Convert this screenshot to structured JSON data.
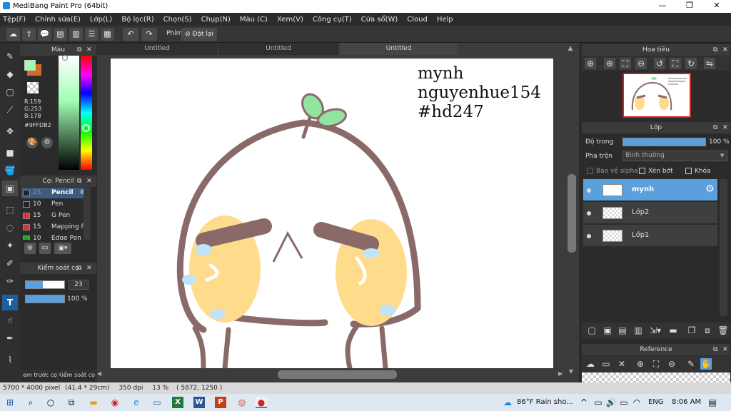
{
  "window": {
    "title": "MediBang Paint Pro (64bit)",
    "controls": [
      "—",
      "❐",
      "✕"
    ]
  },
  "menu": [
    "Tệp(F)",
    "Chỉnh sửa(E)",
    "Lớp(L)",
    "Bộ lọc(R)",
    "Chọn(S)",
    "Chụp(N)",
    "Màu (C)",
    "Xem(V)",
    "Công cụ(T)",
    "Cửa sổ(W)",
    "Cloud",
    "Help"
  ],
  "toolbar": {
    "shortcut_label": "Phím",
    "reset_label": "Đặt lại"
  },
  "color_panel": {
    "title": "Màu",
    "r": "R:159",
    "g": "G:253",
    "b": "B:178",
    "hex": "#9FFDB2",
    "fg_color": "#9FFDB2",
    "bg_color": "#D06A2A"
  },
  "brush_panel": {
    "title": "Cọ: Pencil",
    "brushes": [
      {
        "size": "23",
        "name": "Pencil",
        "color": "#222222",
        "selected": true
      },
      {
        "size": "10",
        "name": "Pen",
        "color": "#222222",
        "selected": false
      },
      {
        "size": "15",
        "name": "G Pen",
        "color": "#e03030",
        "selected": false
      },
      {
        "size": "15",
        "name": "Mapping Pen",
        "color": "#e03030",
        "selected": false
      },
      {
        "size": "10",
        "name": "Edge Pen",
        "color": "#22aa22",
        "selected": false
      }
    ]
  },
  "brush_control": {
    "title": "Kiểm soát cọ",
    "size_value": "23",
    "opacity_value": "100 %"
  },
  "bottom_tabs": [
    "em trước cọ",
    "Kiểm soát cọ"
  ],
  "doc_tabs": [
    "Untitled",
    "Untitled",
    "Untitled"
  ],
  "canvas": {
    "text_lines": [
      "mynh",
      "nguyenhue154",
      "#hd247"
    ]
  },
  "navigator": {
    "title": "Hoa tiêu"
  },
  "layer_panel": {
    "title": "Lớp",
    "opacity_label": "Độ trong",
    "opacity_value": "100 %",
    "blend_label": "Pha trộn",
    "blend_value": "Bình thường",
    "protect_alpha": "Bảo vệ alpha",
    "clipping": "Xén bớt",
    "lock": "Khóa",
    "layers": [
      {
        "name": "mynh",
        "selected": true
      },
      {
        "name": "Lớp2",
        "selected": false
      },
      {
        "name": "Lớp1",
        "selected": false
      }
    ]
  },
  "reference_panel": {
    "title": "Reference"
  },
  "status": {
    "size": "5700 * 4000 pixel",
    "size_cm": "(41.4 * 29cm)",
    "dpi": "350 dpi",
    "zoom": "13 %",
    "cursor": "( 5872, 1250 )"
  },
  "taskbar": {
    "weather": "86°F  Rain sho...",
    "lang": "ENG",
    "time": "8:06 AM"
  }
}
